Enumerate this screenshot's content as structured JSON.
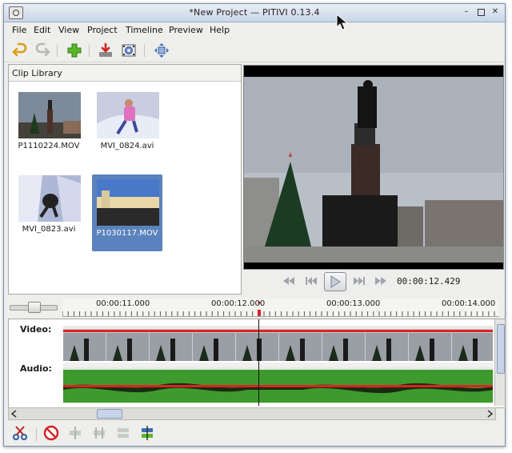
{
  "window": {
    "title": "*New Project — PITIVI 0.13.4"
  },
  "menu": {
    "items": [
      "File",
      "Edit",
      "View",
      "Project",
      "Timeline",
      "Preview",
      "Help"
    ]
  },
  "toolbar": {
    "icons": [
      "undo-icon",
      "redo-icon",
      "import-clips-icon",
      "render-icon",
      "project-settings-icon",
      "fullscreen-icon"
    ]
  },
  "library": {
    "header": "Clip Library",
    "clips": [
      {
        "name": "P1110224.MOV",
        "selected": false
      },
      {
        "name": "MVI_0824.avi",
        "selected": false
      },
      {
        "name": "MVI_0823.avi",
        "selected": false
      },
      {
        "name": "P1030117.MOV",
        "selected": true
      }
    ]
  },
  "viewer": {
    "timecode": "00:00:12.429"
  },
  "timeline": {
    "ruler_labels": [
      "00:00:11.000",
      "00:00:12.000",
      "00:00:13.000",
      "00:00:14.000"
    ],
    "tracks": {
      "video_label": "Video:",
      "audio_label": "Audio:"
    }
  },
  "colors": {
    "accent": "#5a82bd",
    "playhead": "#e02020",
    "audio": "#3a9a2a"
  }
}
